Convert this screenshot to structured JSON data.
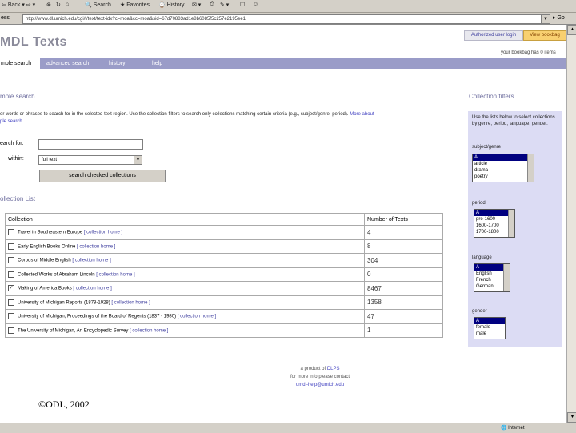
{
  "browser": {
    "toolbar": {
      "back": "Back",
      "search": "Search",
      "favorites": "Favorites",
      "history": "History"
    },
    "address_label": "ess",
    "address_value": "http://www.dl.umich.edu/cgi/t/text/text-idx?c=moa&cc=moa&sid=67d70883ad1e8b6085f5c257e2195ee1",
    "go_label": "Go"
  },
  "header": {
    "logo": "MDL Texts",
    "authorized_link": "Authorized user login",
    "view_bookbag": "View bookbag",
    "bookbag_status": "your bookbag has 0 items"
  },
  "nav": {
    "tabs": [
      "mple search",
      "advanced search",
      "history",
      "help"
    ]
  },
  "main": {
    "title": "mple search",
    "intro": "er words or phrases to search for in the selected text region. Use the collection filters to search only collections matching certain criteria (e.g., subject/genre, period).",
    "intro_link1": "More about",
    "intro_link2": "ple search",
    "search_for_label": "earch for:",
    "search_for_value": "",
    "within_label": "within:",
    "within_value": "full text",
    "search_button": "search checked collections"
  },
  "collection_list": {
    "title": "ollection List",
    "headers": [
      "Collection",
      "Number of Texts"
    ],
    "link_text": "[ collection home ]",
    "rows": [
      {
        "name": "Travel in Southeastern Europe",
        "count": "4",
        "checked": false
      },
      {
        "name": "Early English Books Online",
        "count": "8",
        "checked": false
      },
      {
        "name": "Corpus of Middle English",
        "count": "304",
        "checked": false
      },
      {
        "name": "Collected Works of Abraham Lincoln",
        "count": "0",
        "checked": false
      },
      {
        "name": "Making of America Books",
        "count": "8467",
        "checked": true
      },
      {
        "name": "University of Michigan Reports (1878-1928)",
        "count": "1358",
        "checked": false
      },
      {
        "name": "University of Michigan, Proceedings of the Board of Regents (1837 - 1980)",
        "count": "47",
        "checked": false
      },
      {
        "name": "The University of Michigan, An Encyclopedic Survey",
        "count": "1",
        "checked": false
      }
    ]
  },
  "footer": {
    "line1_prefix": "a product of ",
    "line1_link": "DLPS",
    "line2": "for more info please contact",
    "line3": "umdl-help@umich.edu",
    "copyright": "©ODL, 2002"
  },
  "filters": {
    "title": "Collection filters",
    "help": "Use the lists below to select collections by genre, period, language, gender.",
    "groups": [
      {
        "label": "subject/genre",
        "options": [
          "A",
          "article",
          "drama",
          "poetry"
        ]
      },
      {
        "label": "period",
        "options": [
          "A",
          "pre-1600",
          "1600-1700",
          "1700-1800"
        ]
      },
      {
        "label": "language",
        "options": [
          "A",
          "English",
          "French",
          "German"
        ]
      },
      {
        "label": "gender",
        "options": [
          "A",
          "female",
          "male"
        ]
      }
    ]
  },
  "status": {
    "zone": "Internet"
  }
}
